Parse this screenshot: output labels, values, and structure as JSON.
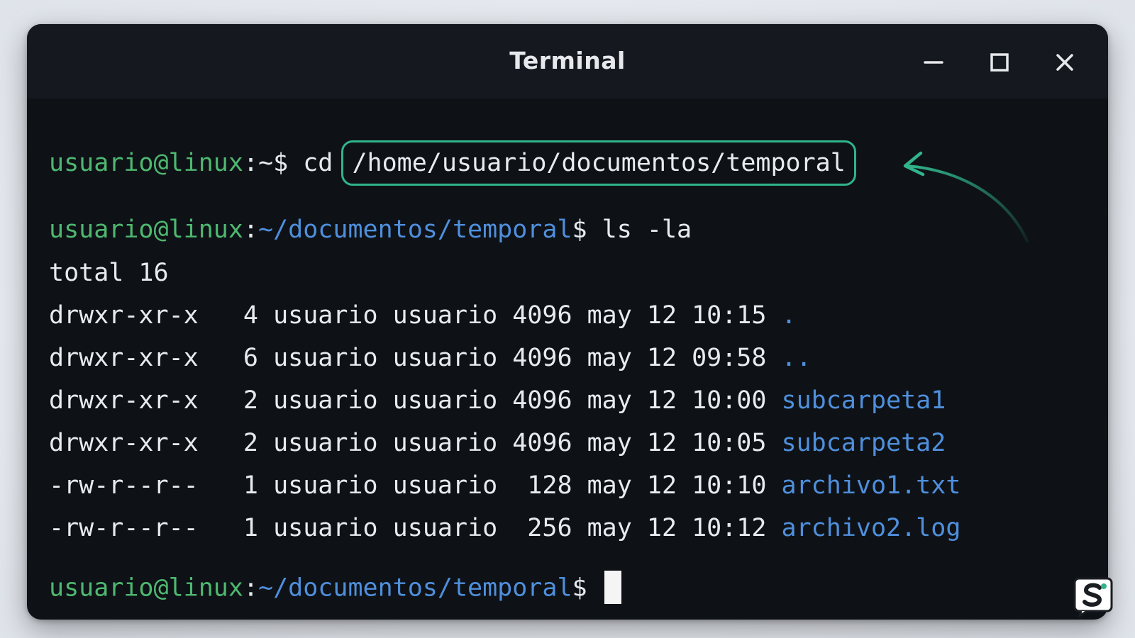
{
  "window": {
    "title": "Terminal"
  },
  "colors": {
    "user_prompt": "#4fb870",
    "path": "#4f8fdc",
    "text": "#e8eaed",
    "highlight": "#31b48a",
    "background": "#0e1217",
    "titlebar": "#15191f"
  },
  "icons": {
    "minimize": "minimize-icon",
    "maximize": "maximize-icon",
    "close": "close-icon",
    "logo": "s-logo-icon"
  },
  "terminal": {
    "line1": {
      "user": "usuario@linux",
      "path": ":~$",
      "command": " cd ",
      "argument": "/home/usuario/documentos/temporal"
    },
    "line2": {
      "user": "usuario@linux",
      "colon": ":",
      "path": "~/documentos/temporal",
      "dollar": "$",
      "command": " ls -la"
    },
    "total": "total 16",
    "listing": [
      {
        "meta": "drwxr-xr-x   4 usuario usuario 4096 may 12 10:15 ",
        "name": "."
      },
      {
        "meta": "drwxr-xr-x   6 usuario usuario 4096 may 12 09:58 ",
        "name": ".."
      },
      {
        "meta": "drwxr-xr-x   2 usuario usuario 4096 may 12 10:00 ",
        "name": "subcarpeta1"
      },
      {
        "meta": "drwxr-xr-x   2 usuario usuario 4096 may 12 10:05 ",
        "name": "subcarpeta2"
      },
      {
        "meta": "-rw-r--r--   1 usuario usuario  128 may 12 10:10 ",
        "name": "archivo1.txt"
      },
      {
        "meta": "-rw-r--r--   1 usuario usuario  256 may 12 10:12 ",
        "name": "archivo2.log"
      }
    ],
    "line_final": {
      "user": "usuario@linux",
      "colon": ":",
      "path": "~/documentos/temporal",
      "dollar": "$"
    }
  }
}
